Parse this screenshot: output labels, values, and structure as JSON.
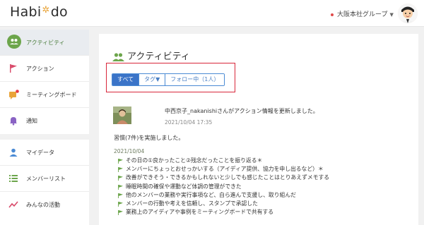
{
  "header": {
    "logo_left": "Habi",
    "logo_star": "✲",
    "logo_right": "do",
    "org_label": "大阪本社グループ",
    "colors": {
      "accent": "#4b7d3d",
      "red": "#d8263a",
      "blue": "#3b74c8"
    }
  },
  "sidebar": {
    "items": [
      {
        "label": "アクティビティ",
        "icon": "people-icon",
        "active": true
      },
      {
        "label": "アクション",
        "icon": "flag-icon"
      },
      {
        "label": "ミーティングボード",
        "icon": "chat-icon"
      },
      {
        "label": "通知",
        "icon": "bell-icon"
      },
      {
        "label": "マイデータ",
        "icon": "person-icon"
      },
      {
        "label": "メンバーリスト",
        "icon": "list-icon"
      },
      {
        "label": "みんなの活動",
        "icon": "trend-icon"
      }
    ]
  },
  "main": {
    "title": "アクティビティ",
    "tabs": [
      {
        "label": "すべて",
        "active": true
      },
      {
        "label": "タグ▼"
      },
      {
        "label": "フォロー中（1人）"
      }
    ],
    "post": {
      "headline": "中西京子_nakanishiさんがアクション情報を更新しました。",
      "time": "2021/10/04 17:35",
      "summary": "習慣(7件)を実施しました。",
      "date": "2021/10/04",
      "items": [
        "その日の①良かったこと②残念だったことを振り返る＊",
        "メンバーにちょっとおせっかいする（アイディア提供、協力を申し出るなど）＊",
        "改善ができそう・できるかもしれないと少しでも感じたことはとりあえずメモする",
        "睡眠時間の確保や運動など体調の管理ができた",
        "他のメンバーの業務や実行事項など、自ら進んで支援し、取り組んだ",
        "メンバーの行動や考えを信頼し、スタンプで承認した",
        "業務上のアイディアや事例をミーティングボードで共有する"
      ]
    }
  }
}
